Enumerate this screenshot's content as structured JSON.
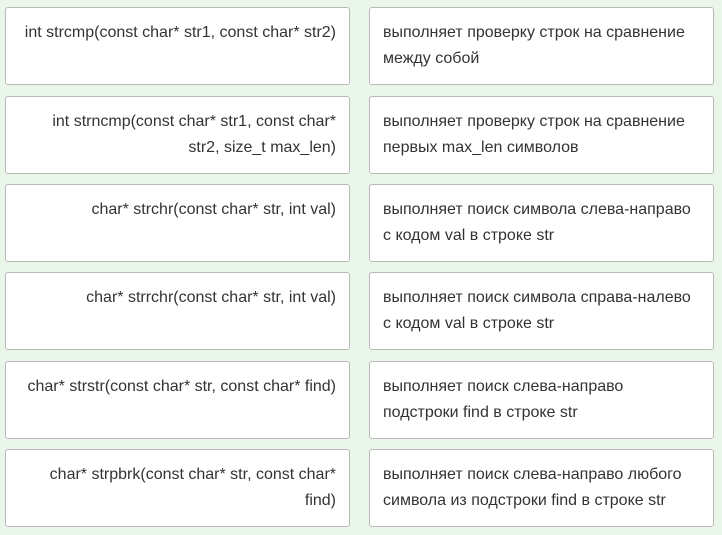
{
  "pairs": [
    {
      "function": "int strcmp(const char* str1, const char* str2)",
      "description": "выполняет проверку строк на сравнение между собой"
    },
    {
      "function": "int strncmp(const char* str1, const char* str2, size_t max_len)",
      "description": "выполняет проверку строк на сравнение первых max_len символов"
    },
    {
      "function": "char* strchr(const char* str, int val)",
      "description": "выполняет поиск символа слева-направо с кодом val в строке str"
    },
    {
      "function": "char* strrchr(const char* str, int val)",
      "description": "выполняет поиск символа справа-налево с кодом val в строке str"
    },
    {
      "function": "char* strstr(const char* str, const char* find)",
      "description": "выполняет поиск слева-направо подстроки find в строке str"
    },
    {
      "function": "char* strpbrk(const char* str, const char* find)",
      "description": "выполняет поиск слева-направо любого символа из подстроки find в строке str"
    }
  ]
}
